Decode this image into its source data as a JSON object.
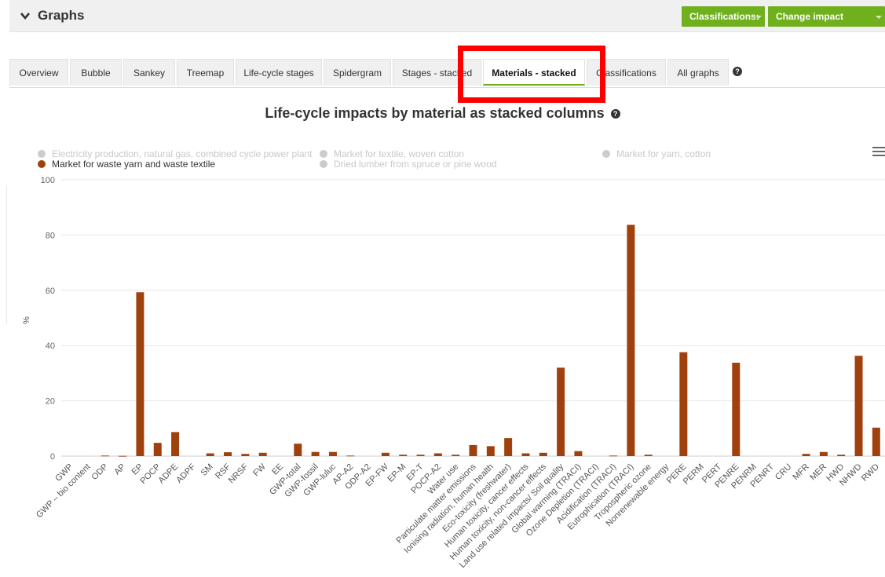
{
  "header": {
    "title": "Graphs",
    "classifications_button": "Classifications:",
    "change_impact_button": "Change impact category"
  },
  "tabs": [
    {
      "label": "Overview"
    },
    {
      "label": "Bubble"
    },
    {
      "label": "Sankey"
    },
    {
      "label": "Treemap"
    },
    {
      "label": "Life-cycle stages"
    },
    {
      "label": "Spidergram"
    },
    {
      "label": "Stages - stacked"
    },
    {
      "label": "Materials - stacked",
      "active": true
    },
    {
      "label": "Classifications"
    },
    {
      "label": "All graphs"
    }
  ],
  "colors": {
    "accent": "#6fb01c",
    "highlight": "#ff0000",
    "series": "#a0410d",
    "legend_disabled": "#cccccc"
  },
  "chart_data": {
    "type": "bar",
    "title": "Life-cycle impacts by material as stacked columns",
    "ylabel": "%",
    "ylim": [
      0,
      100
    ],
    "yticks": [
      0,
      20,
      40,
      60,
      80,
      100
    ],
    "grid": true,
    "legend": [
      {
        "name": "Electricity production, natural gas, combined cycle power plant",
        "visible": false
      },
      {
        "name": "Market for textile, woven cotton",
        "visible": false
      },
      {
        "name": "Market for yarn, cotton",
        "visible": false
      },
      {
        "name": "Market for waste yarn and waste textile",
        "visible": true
      },
      {
        "name": "Dried lumber from spruce or pine wood",
        "visible": false
      }
    ],
    "categories": [
      "GWP",
      "GWP – bio content",
      "ODP",
      "AP",
      "EP",
      "POCP",
      "ADPE",
      "ADPF",
      "SM",
      "RSF",
      "NRSF",
      "FW",
      "EE",
      "GWP-total",
      "GWP-fossil",
      "GWP-luluc",
      "AP-A2",
      "ODP-A2",
      "EP-FW",
      "EP-M",
      "EP-T",
      "POCP-A2",
      "Water use",
      "Particulate matter emissions",
      "Ionising radiation, human health",
      "Eco-toxicity (freshwater)",
      "Human toxicity, cancer effects",
      "Human toxicity, non-cancer effects",
      "Land use related impacts/ Soil quality",
      "Global warming (TRACI)",
      "Ozone Depletion (TRACI)",
      "Acidification (TRACI)",
      "Eutrophication (TRACI)",
      "Tropospheric ozone",
      "Nonrenewable energy",
      "PERE",
      "PERM",
      "PERT",
      "PENRE",
      "PENRM",
      "PENRT",
      "CRU",
      "MFR",
      "MER",
      "HWD",
      "NHWD",
      "RWD"
    ],
    "series": [
      {
        "name": "Market for waste yarn and waste textile",
        "values": [
          0,
          0,
          0.2,
          0.1,
          59.3,
          4.8,
          8.7,
          0,
          1.0,
          1.4,
          0.8,
          1.2,
          0,
          4.5,
          1.5,
          1.5,
          0.2,
          0,
          1.2,
          0.5,
          0.5,
          1.0,
          0.5,
          4.0,
          3.6,
          6.5,
          1.0,
          1.2,
          32.0,
          1.8,
          0,
          0.2,
          83.7,
          0.5,
          0,
          37.6,
          0,
          0,
          33.8,
          0,
          0,
          0,
          0.8,
          1.5,
          0.5,
          36.3,
          10.3
        ]
      }
    ]
  }
}
